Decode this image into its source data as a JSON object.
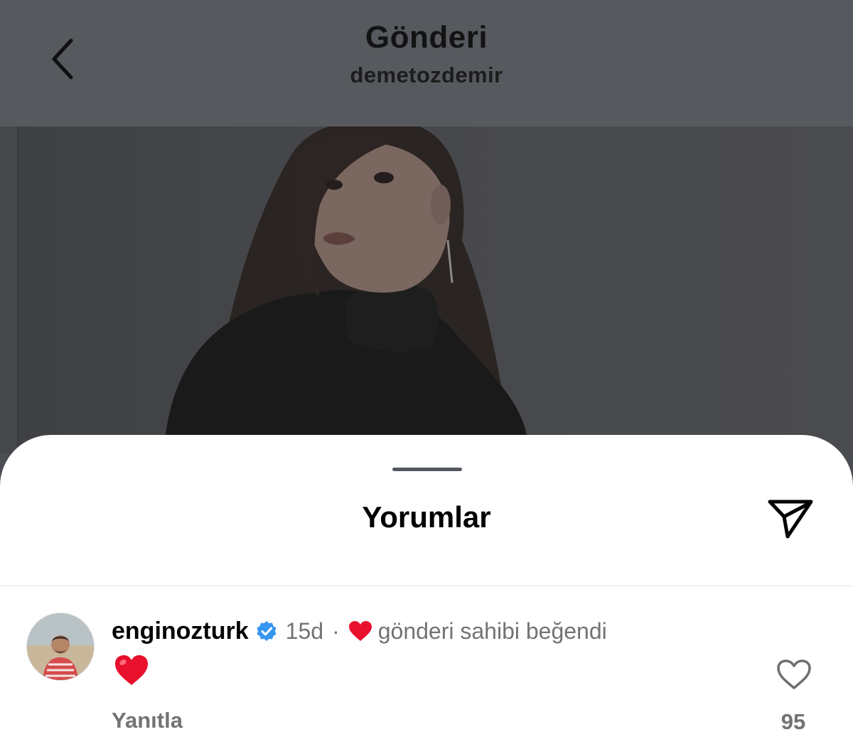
{
  "header": {
    "title": "Gönderi",
    "subtitle": "demetozdemir",
    "back_icon": "chevron-left-icon"
  },
  "photo": {
    "description_icon": "post-photo"
  },
  "sheet": {
    "title": "Yorumlar",
    "share_icon": "send-icon"
  },
  "comment": {
    "username": "enginozturk",
    "verified_icon": "verified-badge-icon",
    "time": "15d",
    "separator": "·",
    "liked_by_author_icon": "red-heart-icon",
    "liked_by_author_text": "gönderi sahibi beğendi",
    "text_emoji": "red-heart-emoji",
    "reply_label": "Yanıtla",
    "like_icon": "heart-outline-icon",
    "like_count": "95"
  },
  "colors": {
    "heart_red": "#e8102d",
    "verified_blue": "#3797f0",
    "muted_text": "#737373"
  }
}
